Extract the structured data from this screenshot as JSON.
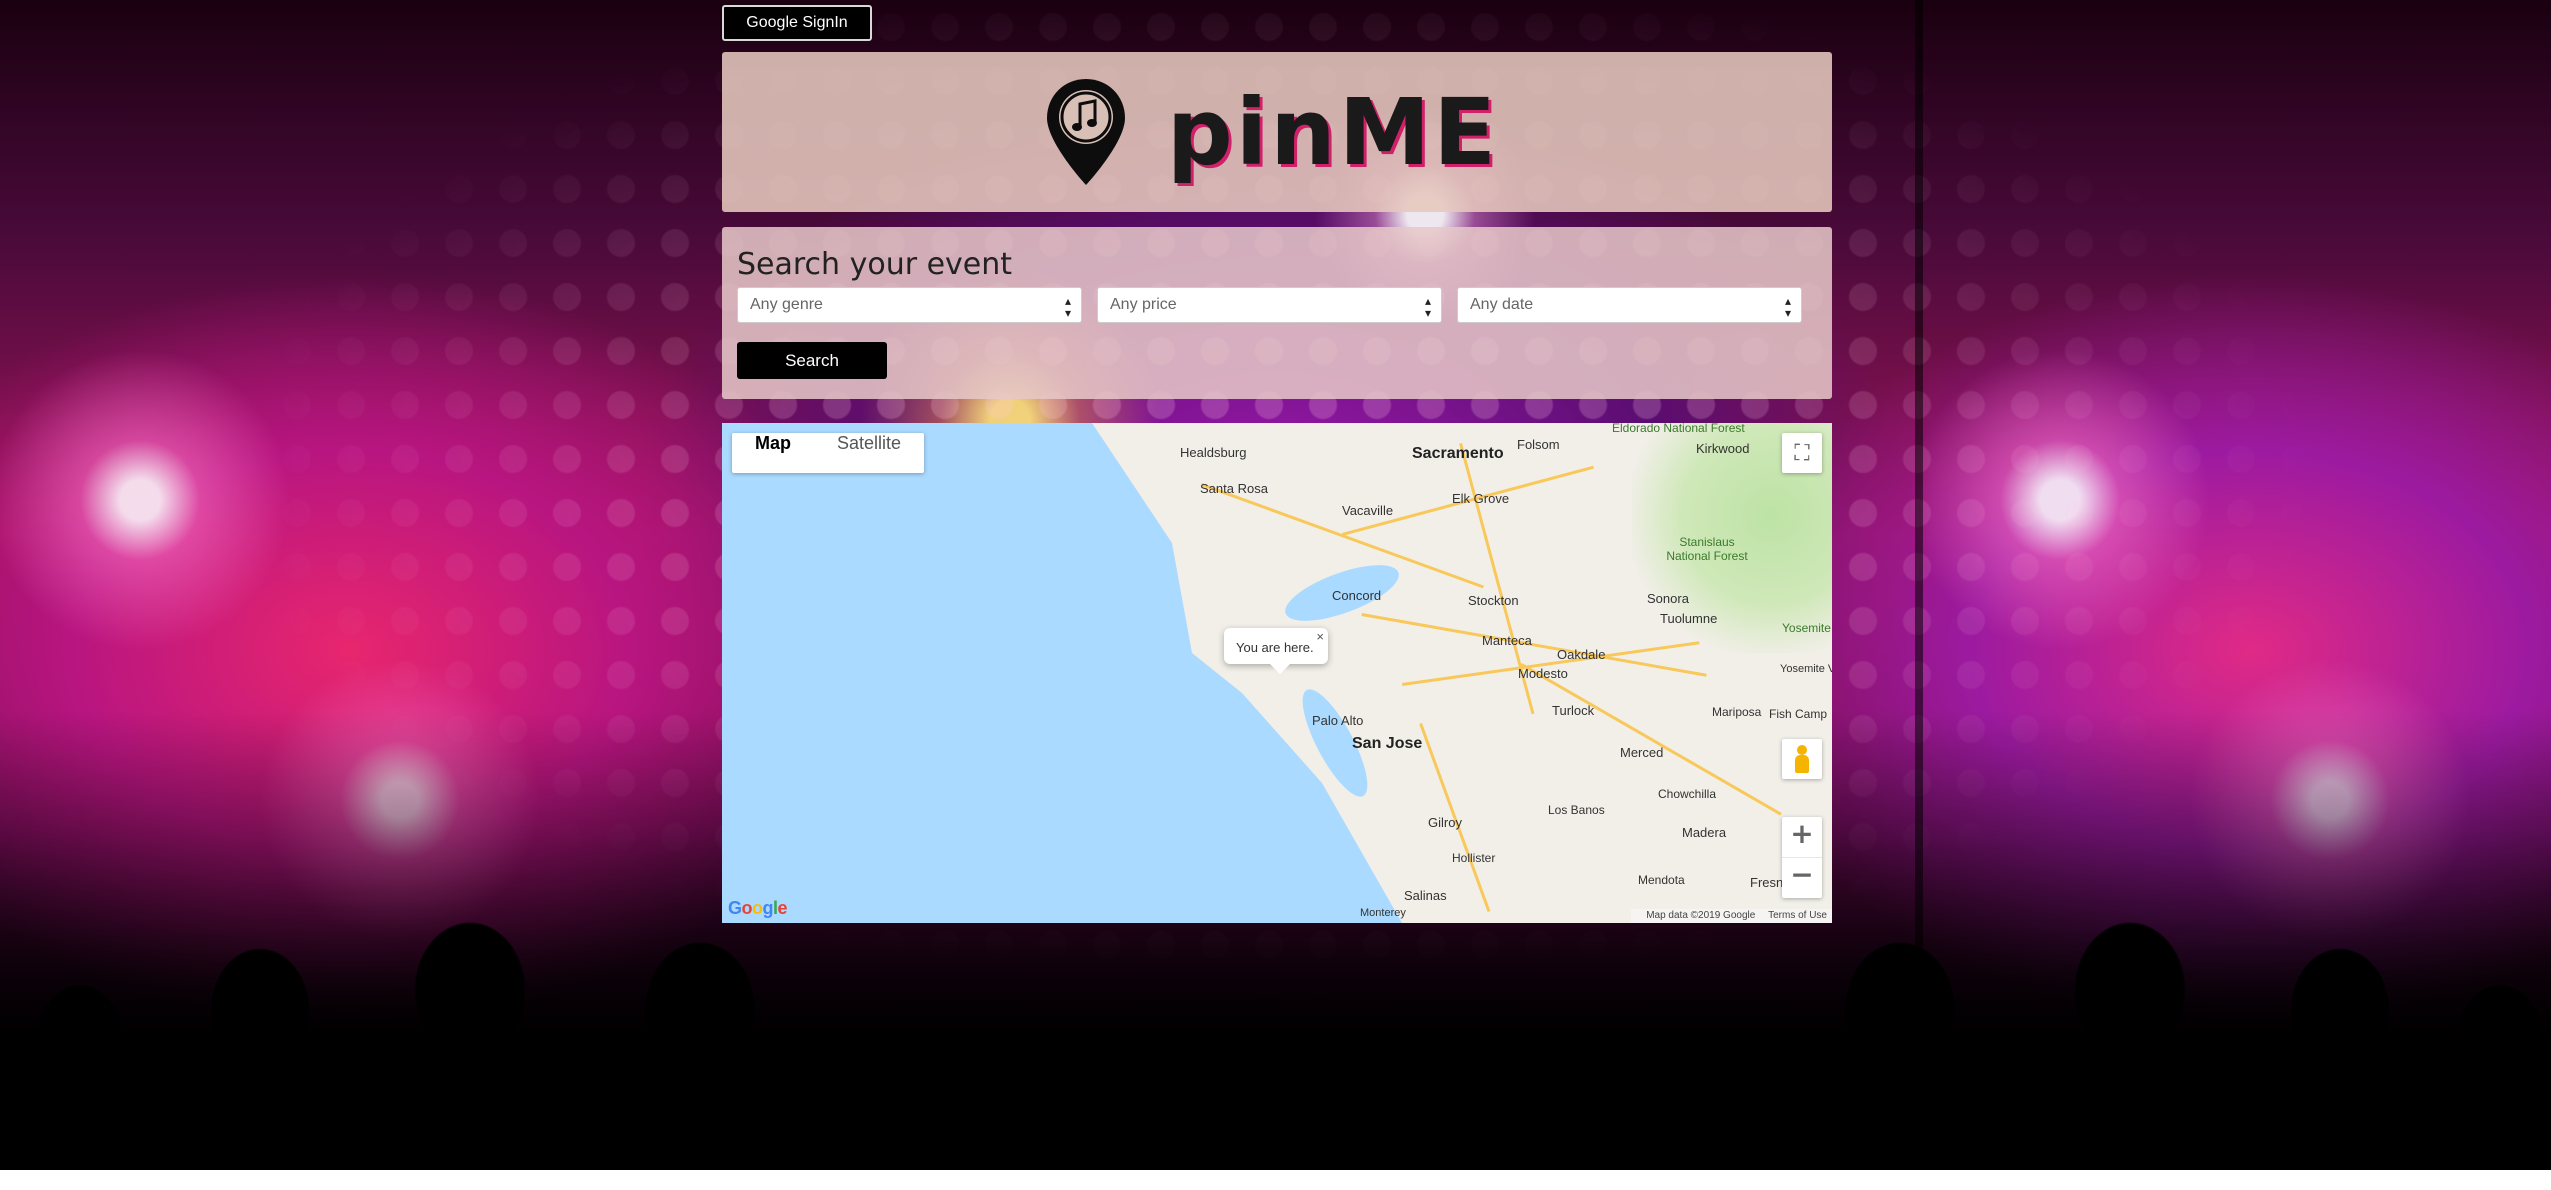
{
  "header": {
    "signin_label": "Google SignIn"
  },
  "logo": {
    "text": "pinME",
    "icon": "music-pin-icon"
  },
  "search": {
    "title": "Search your event",
    "genre": "Any genre",
    "price": "Any price",
    "date": "Any date",
    "button_label": "Search"
  },
  "map": {
    "type_map": "Map",
    "type_satellite": "Satellite",
    "infowindow_text": "You are here.",
    "infowindow_close": "×",
    "attribution": "Map data ©2019 Google",
    "terms": "Terms of Use",
    "zoom_in": "+",
    "zoom_out": "−",
    "cities": {
      "healdsburg": "Healdsburg",
      "santa_rosa": "Santa Rosa",
      "sacramento": "Sacramento",
      "folsom": "Folsom",
      "elk_grove": "Elk Grove",
      "vacaville": "Vacaville",
      "concord": "Concord",
      "stockton": "Stockton",
      "manteca": "Manteca",
      "modesto": "Modesto",
      "oakdale": "Oakdale",
      "turlock": "Turlock",
      "palo_alto": "Palo Alto",
      "san_jose": "San Jose",
      "merced": "Merced",
      "gilroy": "Gilroy",
      "los_banos": "Los Banos",
      "hollister": "Hollister",
      "salinas": "Salinas",
      "monterey": "Monterey",
      "madera": "Madera",
      "chowchilla": "Chowchilla",
      "mendota": "Mendota",
      "fresno": "Fresn",
      "sonora": "Sonora",
      "tuolumne": "Tuolumne",
      "mariposa": "Mariposa",
      "fish_camp": "Fish Camp",
      "kirkwood": "Kirkwood",
      "eldorado": "Eldorado National Forest",
      "stanislaus": "Stanislaus National Forest",
      "yosemite_np": "Yosemite National Pa",
      "yosemite_village": "Yosemite Village"
    }
  }
}
